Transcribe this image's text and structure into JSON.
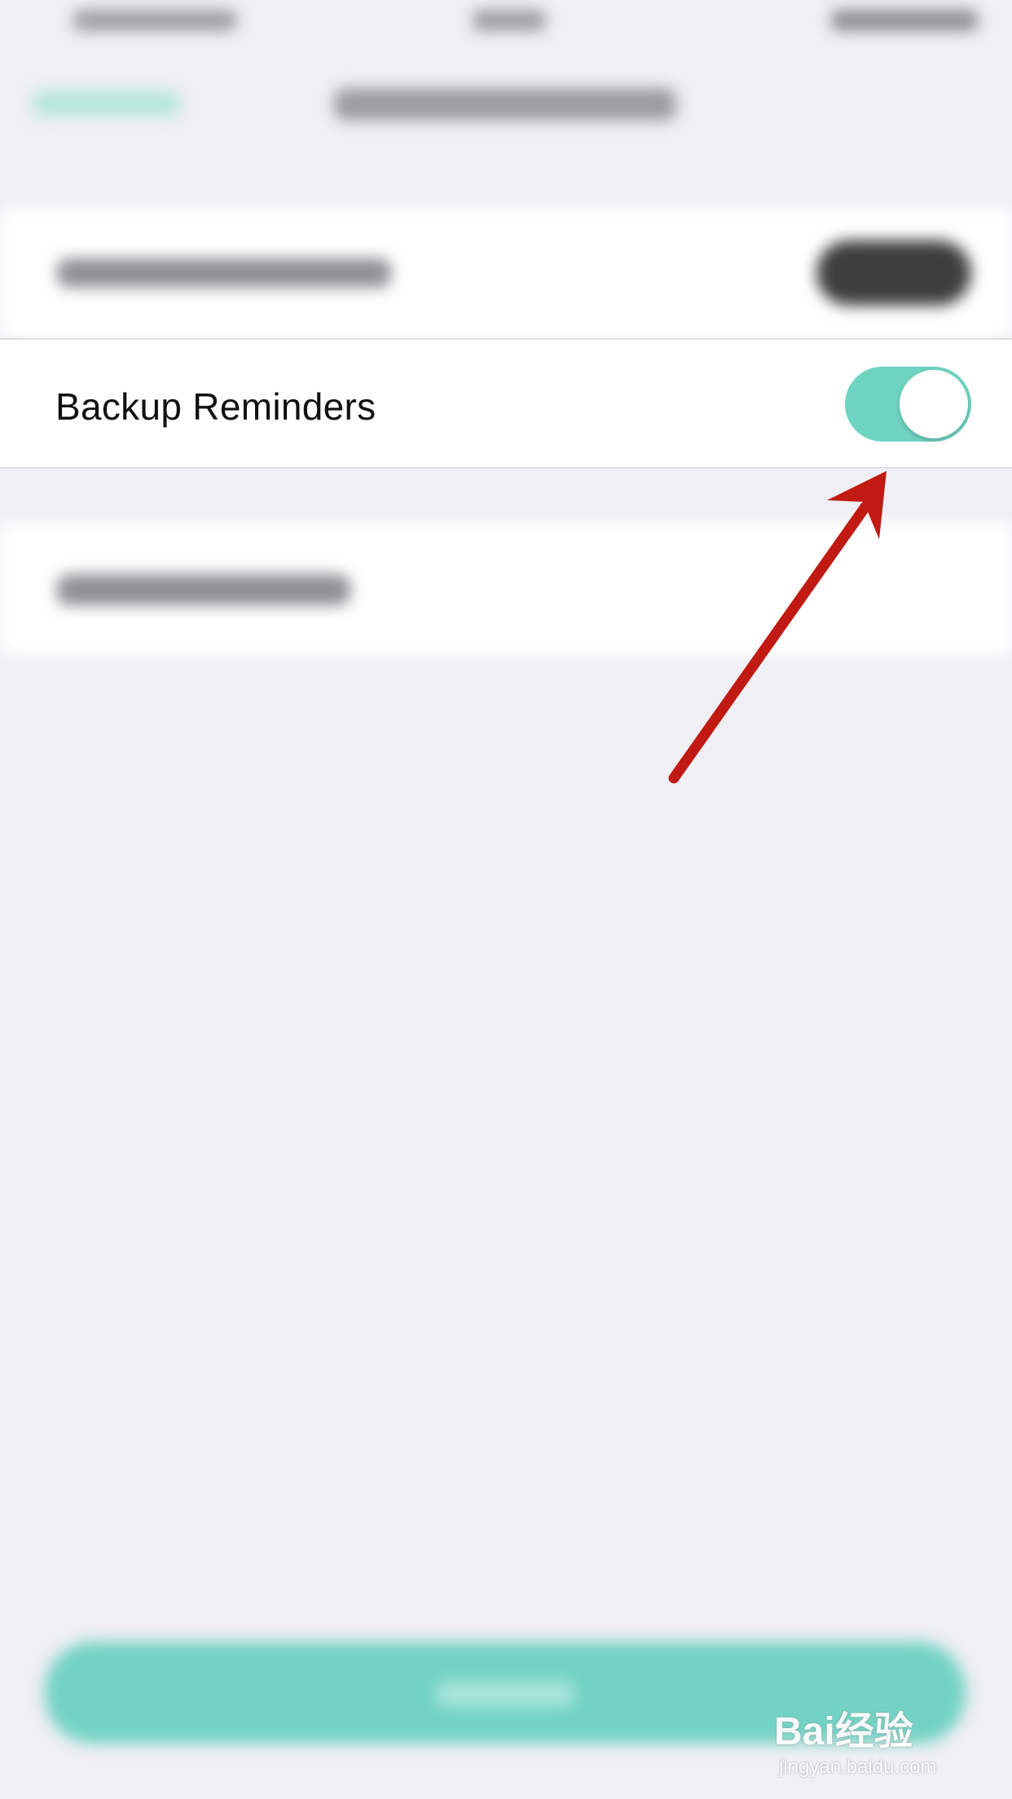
{
  "settings": {
    "backup_reminders": {
      "label": "Backup Reminders",
      "toggle_on": true
    }
  },
  "colors": {
    "accent": "#6fd3c1",
    "background": "#efeff4",
    "arrow": "#c01a12"
  },
  "watermark": {
    "logo": "Bai经验",
    "url": "jingyan.baidu.com"
  }
}
